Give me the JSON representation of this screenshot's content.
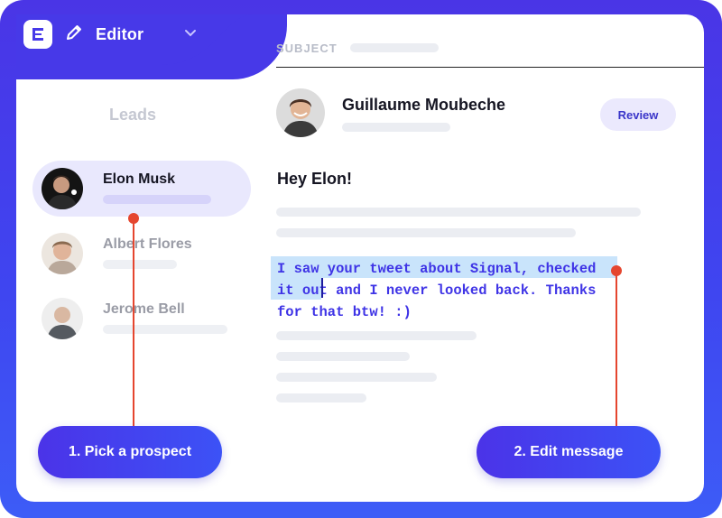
{
  "header": {
    "title": "Editor",
    "logo_icon": "editor-logo-icon",
    "pencil_icon": "pencil-icon",
    "chevron_icon": "chevron-down-icon"
  },
  "subject": {
    "label": "SUBJECT"
  },
  "leads": {
    "title": "Leads",
    "items": [
      {
        "name": "Elon Musk",
        "active": true
      },
      {
        "name": "Albert Flores",
        "active": false
      },
      {
        "name": "Jerome Bell",
        "active": false
      }
    ]
  },
  "sender": {
    "name": "Guillaume Moubeche",
    "review_label": "Review"
  },
  "email": {
    "greeting": "Hey Elon!",
    "message_line1": "I saw your tweet about Signal, checked",
    "message_line2": "it out and I never looked back. Thanks",
    "message_line3": "for that btw! :)"
  },
  "steps": {
    "step1": "1. Pick a prospect",
    "step2": "2. Edit message"
  },
  "colors": {
    "brand": "#4739e8",
    "accent_text": "#3f34e6",
    "highlight": "#c9e4fb",
    "connector": "#e5462f"
  }
}
